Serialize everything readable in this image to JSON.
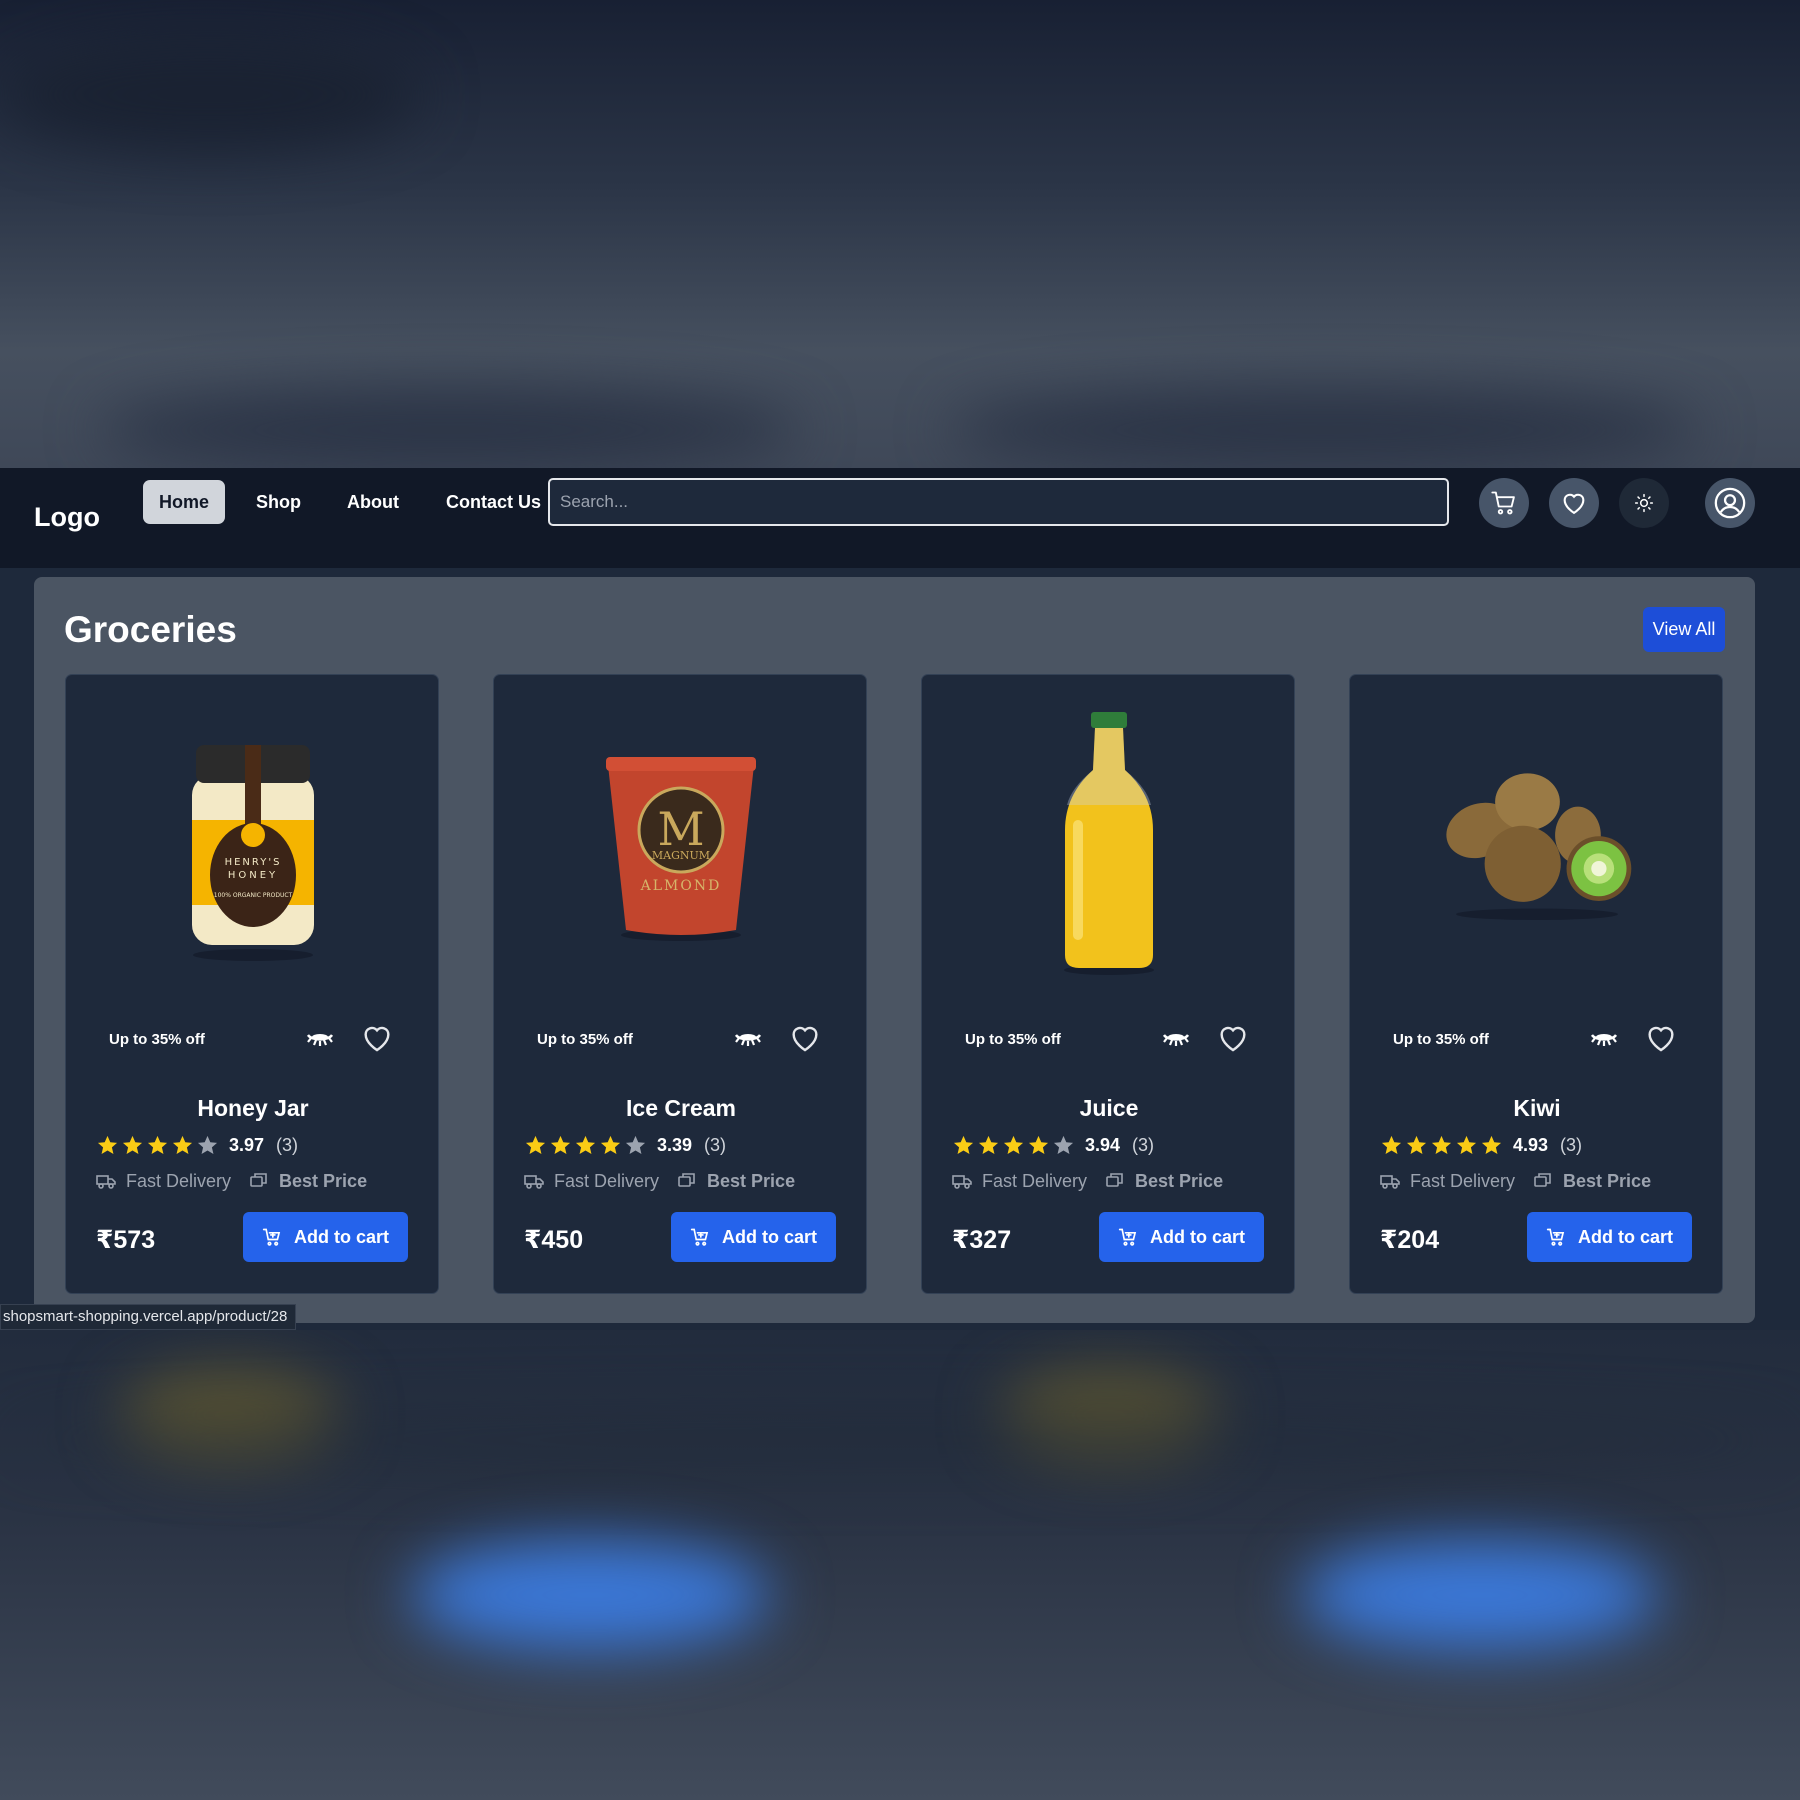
{
  "navbar": {
    "logo": "Logo",
    "links": [
      "Home",
      "Shop",
      "About",
      "Contact Us"
    ],
    "active_link": "Home",
    "search_placeholder": "Search..."
  },
  "section": {
    "title": "Groceries",
    "view_all_label": "View All"
  },
  "products": [
    {
      "name": "Honey Jar",
      "promo": "Up to 35% off",
      "rating": "3.97",
      "reviews": "(3)",
      "stars": 4,
      "delivery": "Fast Delivery",
      "best_price": "Best Price",
      "price": "₹573",
      "cta": "Add to cart"
    },
    {
      "name": "Ice Cream",
      "promo": "Up to 35% off",
      "rating": "3.39",
      "reviews": "(3)",
      "stars": 4,
      "delivery": "Fast Delivery",
      "best_price": "Best Price",
      "price": "₹450",
      "cta": "Add to cart"
    },
    {
      "name": "Juice",
      "promo": "Up to 35% off",
      "rating": "3.94",
      "reviews": "(3)",
      "stars": 4,
      "delivery": "Fast Delivery",
      "best_price": "Best Price",
      "price": "₹327",
      "cta": "Add to cart"
    },
    {
      "name": "Kiwi",
      "promo": "Up to 35% off",
      "rating": "4.93",
      "reviews": "(3)",
      "stars": 5,
      "delivery": "Fast Delivery",
      "best_price": "Best Price",
      "price": "₹204",
      "cta": "Add to cart"
    }
  ],
  "product_images": {
    "honey_label_line1": "HENRY'S",
    "honey_label_line2": "HONEY",
    "honey_label_line3": "100% ORGANIC PRODUCT",
    "icecream_brand": "MAGNUM",
    "icecream_flavor": "ALMOND"
  },
  "status_bar": {
    "url": "shopsmart-shopping.vercel.app/product/28"
  },
  "colors": {
    "accent": "#2563eb",
    "view_all": "#1d4ed8",
    "star": "#facc15",
    "star_empty": "#9ca3af",
    "nav_bg": "#111827",
    "card_bg": "#1e293b"
  }
}
